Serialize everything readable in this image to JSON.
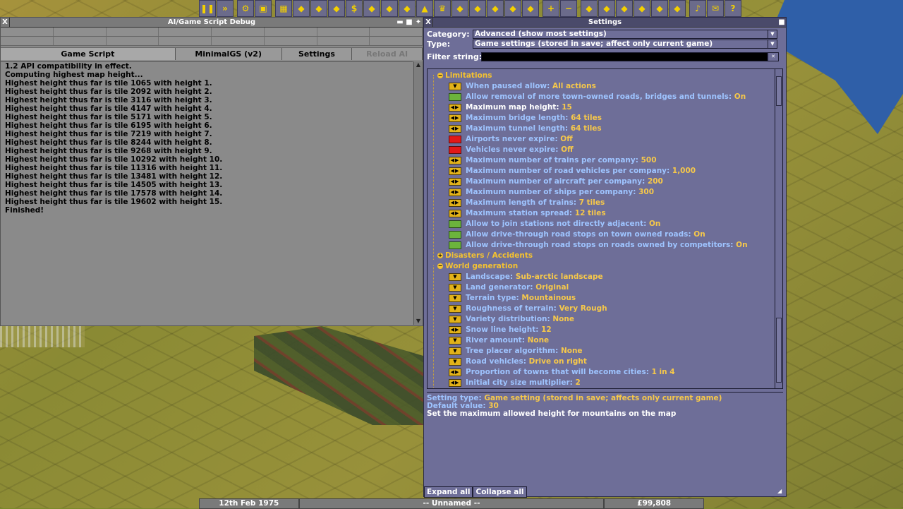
{
  "colors": {
    "accent": "#f4c230",
    "setting_label": "#9ec4ff",
    "value": "#f6c84a",
    "window": "#6e6e98"
  },
  "toolbar": {
    "icons": [
      "pause-icon",
      "fast-forward-icon",
      "options-gear-icon",
      "save-icon",
      "map-icon",
      "town-directory-icon",
      "subsidies-icon",
      "station-list-icon",
      "finances-icon",
      "company-icon",
      "story-book-icon",
      "goal-list-icon",
      "graphs-icon",
      "league-table-icon",
      "industry-icon",
      "train-list-icon",
      "road-vehicle-list-icon",
      "ship-list-icon",
      "aircraft-list-icon",
      "zoom-in-icon",
      "zoom-out-icon",
      "rail-construction-icon",
      "road-construction-icon",
      "tram-construction-icon",
      "water-construction-icon",
      "air-construction-icon",
      "landscaping-icon",
      "music-icon",
      "messages-icon",
      "help-icon"
    ]
  },
  "ai_window": {
    "title": "AI/Game Script Debug",
    "close": "X",
    "tabs": [
      {
        "label": "Game Script"
      },
      {
        "label": "MinimalGS (v2)"
      },
      {
        "label": "Settings"
      },
      {
        "label": "Reload AI"
      }
    ],
    "log": [
      "1.2 API compatibility in effect.",
      "Computing highest map height...",
      "Highest height thus far is tile 1065 with height 1.",
      "Highest height thus far is tile 2092 with height 2.",
      "Highest height thus far is tile 3116 with height 3.",
      "Highest height thus far is tile 4147 with height 4.",
      "Highest height thus far is tile 5171 with height 5.",
      "Highest height thus far is tile 6195 with height 6.",
      "Highest height thus far is tile 7219 with height 7.",
      "Highest height thus far is tile 8244 with height 8.",
      "Highest height thus far is tile 9268 with height 9.",
      "Highest height thus far is tile 10292 with height 10.",
      "Highest height thus far is tile 11316 with height 11.",
      "Highest height thus far is tile 13481 with height 12.",
      "Highest height thus far is tile 14505 with height 13.",
      "Highest height thus far is tile 17578 with height 14.",
      "Highest height thus far is tile 19602 with height 15.",
      "Finished!"
    ]
  },
  "settings_window": {
    "title": "Settings",
    "close": "X",
    "category_label": "Category:",
    "category_value": "Advanced (show most settings)",
    "type_label": "Type:",
    "type_value": "Game settings (stored in save; affect only current game)",
    "filter_label": "Filter string:",
    "filter_value": "",
    "items": [
      {
        "kind": "cat",
        "label": "Limitations",
        "expanded": true
      },
      {
        "kind": "set",
        "ctrl": "drop",
        "label": "When paused allow: ",
        "value": "All actions"
      },
      {
        "kind": "set",
        "ctrl": "on",
        "label": "Allow removal of more town-owned roads, bridges and tunnels: ",
        "value": "On"
      },
      {
        "kind": "set",
        "ctrl": "arrows",
        "label": "Maximum map height: ",
        "value": "15",
        "selected": true
      },
      {
        "kind": "set",
        "ctrl": "arrows",
        "label": "Maximum bridge length: ",
        "value": "64 tiles"
      },
      {
        "kind": "set",
        "ctrl": "arrows",
        "label": "Maximum tunnel length: ",
        "value": "64 tiles"
      },
      {
        "kind": "set",
        "ctrl": "off",
        "label": "Airports never expire: ",
        "value": "Off"
      },
      {
        "kind": "set",
        "ctrl": "off",
        "label": "Vehicles never expire: ",
        "value": "Off"
      },
      {
        "kind": "set",
        "ctrl": "arrows",
        "label": "Maximum number of trains per company: ",
        "value": "500"
      },
      {
        "kind": "set",
        "ctrl": "arrows",
        "label": "Maximum number of road vehicles per company: ",
        "value": "1,000"
      },
      {
        "kind": "set",
        "ctrl": "arrows",
        "label": "Maximum number of aircraft per company: ",
        "value": "200"
      },
      {
        "kind": "set",
        "ctrl": "arrows",
        "label": "Maximum number of ships per company: ",
        "value": "300"
      },
      {
        "kind": "set",
        "ctrl": "arrows",
        "label": "Maximum length of trains: ",
        "value": "7 tiles"
      },
      {
        "kind": "set",
        "ctrl": "arrows",
        "label": "Maximum station spread: ",
        "value": "12 tiles"
      },
      {
        "kind": "set",
        "ctrl": "on",
        "label": "Allow to join stations not directly adjacent: ",
        "value": "On"
      },
      {
        "kind": "set",
        "ctrl": "on",
        "label": "Allow drive-through road stops on town owned roads: ",
        "value": "On"
      },
      {
        "kind": "set",
        "ctrl": "on",
        "label": "Allow drive-through road stops on roads owned by competitors: ",
        "value": "On"
      },
      {
        "kind": "cat",
        "label": "Disasters / Accidents",
        "expanded": false
      },
      {
        "kind": "cat",
        "label": "World generation",
        "expanded": true
      },
      {
        "kind": "set",
        "ctrl": "drop",
        "label": "Landscape: ",
        "value": "Sub-arctic landscape"
      },
      {
        "kind": "set",
        "ctrl": "drop",
        "label": "Land generator: ",
        "value": "Original"
      },
      {
        "kind": "set",
        "ctrl": "drop",
        "label": "Terrain type: ",
        "value": "Mountainous"
      },
      {
        "kind": "set",
        "ctrl": "drop",
        "label": "Roughness of terrain: ",
        "value": "Very Rough"
      },
      {
        "kind": "set",
        "ctrl": "drop",
        "label": "Variety distribution: ",
        "value": "None"
      },
      {
        "kind": "set",
        "ctrl": "arrows",
        "label": "Snow line height: ",
        "value": "12"
      },
      {
        "kind": "set",
        "ctrl": "drop",
        "label": "River amount: ",
        "value": "None"
      },
      {
        "kind": "set",
        "ctrl": "drop",
        "label": "Tree placer algorithm: ",
        "value": "None"
      },
      {
        "kind": "set",
        "ctrl": "drop",
        "label": "Road vehicles: ",
        "value": "Drive on right"
      },
      {
        "kind": "set",
        "ctrl": "arrows",
        "label": "Proportion of towns that will become cities: ",
        "value": "1 in 4"
      },
      {
        "kind": "set",
        "ctrl": "arrows",
        "label": "Initial city size multiplier: ",
        "value": "2"
      }
    ],
    "description": {
      "setting_type_label": "Setting type: ",
      "setting_type_value": "Game setting (stored in save; affects only current game)",
      "default_label": "Default value: ",
      "default_value": "30",
      "help": "Set the maximum allowed height for mountains on the map"
    },
    "expand_all": "Expand all",
    "collapse_all": "Collapse all"
  },
  "statusbar": {
    "date": "12th Feb 1975",
    "company": "-- Unnamed --",
    "money": "£99,808"
  }
}
